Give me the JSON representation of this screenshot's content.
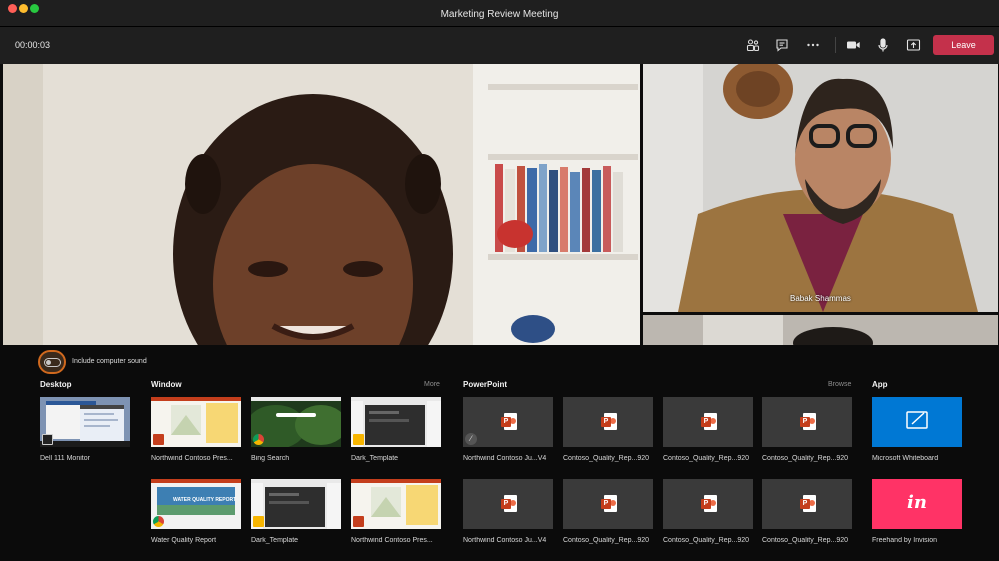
{
  "window": {
    "title": "Marketing Review Meeting"
  },
  "toolbar": {
    "timer": "00:00:03",
    "leave_label": "Leave",
    "icons": [
      "participants-icon",
      "chat-icon",
      "more-icon",
      "camera-icon",
      "microphone-icon",
      "share-icon"
    ]
  },
  "video": {
    "participant_name": "Babak Shammas"
  },
  "tray": {
    "sound_label": "Include computer sound",
    "desktop": {
      "heading": "Desktop",
      "items": [
        {
          "caption": "Dell 111 Monitor"
        }
      ]
    },
    "window": {
      "heading": "Window",
      "link": "More",
      "items": [
        {
          "caption": "Northwind Contoso Pres...",
          "app": "powerpoint"
        },
        {
          "caption": "Bing Search",
          "app": "chrome"
        },
        {
          "caption": "Dark_Template",
          "app": "sketch"
        },
        {
          "caption": "Water Quality Report",
          "app": "chrome"
        },
        {
          "caption": "Dark_Template",
          "app": "sketch"
        },
        {
          "caption": "Northwind Contoso Pres...",
          "app": "powerpoint"
        }
      ],
      "water_banner": "WATER QUALITY REPORT"
    },
    "powerpoint": {
      "heading": "PowerPoint",
      "link": "Browse",
      "items": [
        {
          "caption": "Northwind Contoso Ju...V4"
        },
        {
          "caption": "Contoso_Quality_Rep...920"
        },
        {
          "caption": "Contoso_Quality_Rep...920"
        },
        {
          "caption": "Contoso_Quality_Rep...920"
        },
        {
          "caption": "Northwind Contoso Ju...V4"
        },
        {
          "caption": "Contoso_Quality_Rep...920"
        },
        {
          "caption": "Contoso_Quality_Rep...920"
        },
        {
          "caption": "Contoso_Quality_Rep...920"
        }
      ]
    },
    "app": {
      "heading": "App",
      "items": [
        {
          "caption": "Microsoft Whiteboard",
          "color": "#0078d4"
        },
        {
          "caption": "Freehand by Invision",
          "color": "#ff3366",
          "glyph": "in"
        }
      ]
    }
  },
  "colors": {
    "leave": "#c4314b",
    "toggle_ring": "#d0691e",
    "tray_bg": "#0b0b0b"
  }
}
